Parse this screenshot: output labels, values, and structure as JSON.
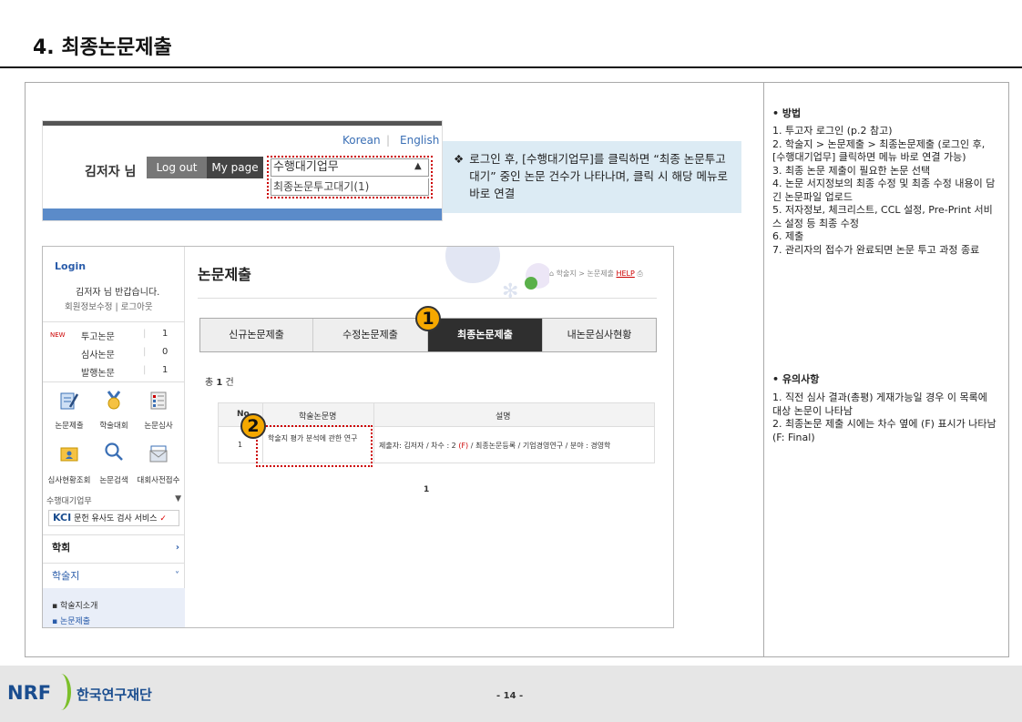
{
  "page": {
    "title": "4. 최종논문제출",
    "page_number": "- 14 -",
    "footer_logo": "NRF",
    "footer_org": "한국연구재단"
  },
  "header_shot": {
    "lang_korean": "Korean",
    "lang_sep": "|",
    "lang_english": "English",
    "user_name": "김저자 님",
    "logout": "Log out",
    "mypage": "My page",
    "dropdown_selected": "수행대기업무",
    "dropdown_arrow": "▲",
    "dropdown_option": "최종논문투고대기(1)"
  },
  "note": {
    "bullet": "❖",
    "text": "로그인 후, [수행대기업무]를 클릭하면 “최종 논문투고대기” 중인 논문 건수가 나타나며, 클릭 시 해당 메뉴로 바로 연결"
  },
  "sidebar": {
    "login": "Login",
    "greeting": "김저자 님 반갑습니다.",
    "links": "회원정보수정 | 로그아웃",
    "new_badge": "NEW",
    "stats": [
      {
        "label": "투고논문",
        "value": "1"
      },
      {
        "label": "심사논문",
        "value": "0"
      },
      {
        "label": "발행논문",
        "value": "1"
      }
    ],
    "icons_row1": [
      {
        "label": "논문제출",
        "icon": "doc-pen-icon"
      },
      {
        "label": "학술대회",
        "icon": "medal-icon"
      },
      {
        "label": "논문심사",
        "icon": "checklist-icon"
      }
    ],
    "icons_row2": [
      {
        "label": "심사현황조회",
        "icon": "folder-user-icon"
      },
      {
        "label": "논문검색",
        "icon": "search-icon"
      },
      {
        "label": "대회사전접수",
        "icon": "mail-icon"
      }
    ],
    "select_label": "수행대기업무",
    "select_arrow": "▼",
    "kci": "KCI",
    "kci_service": "문헌 유사도 검사 서비스",
    "kci_check": "✓",
    "menu_society": "학회",
    "menu_journal": "학술지",
    "submenu": [
      "▪ 학술지소개",
      "▪ 논문제출"
    ]
  },
  "main": {
    "title": "논문제출",
    "breadcrumb": "학술지 > 논문제출",
    "help": "HELP",
    "tabs": [
      "신규논문제출",
      "수정논문제출",
      "최종논문제출",
      "내논문심사현황"
    ],
    "active_tab": 2,
    "count_prefix": "총",
    "count_value": "1",
    "count_suffix": "건",
    "table": {
      "headers": [
        "No",
        "학술논문명",
        "설명"
      ],
      "rows": [
        {
          "no": "1",
          "name": "학술지 평가 분석에 관한 연구",
          "desc_a": "제출자: 김저자 / 차수 : 2",
          "desc_flag": "(F)",
          "desc_b": "/ 최종논문등록 / 기업경영연구 / 분야 : 경영학"
        }
      ]
    },
    "pager": "1"
  },
  "callouts": [
    "1",
    "2"
  ],
  "right_panel": {
    "method_title": "• 방법",
    "steps": [
      "1. 투고자 로그인 (p.2 참고)",
      "2. 학술지 > 논문제출 > 최종논문제출 (로그인 후, [수행대기업무] 클릭하면 메뉴 바로 연결 가능)",
      "3. 최종 논문 제출이 필요한 논문 선택",
      "4. 논문 서지정보의 최종 수정 및 최종 수정 내용이 담긴 논문파일 업로드",
      "5. 저자정보, 체크리스트, CCL 설정, Pre-Print 서비스 설정 등 최종 수정",
      "6. 제출",
      "7. 관리자의 접수가 완료되면 논문 투고 과정 종료"
    ],
    "notes_title": "•   유의사항",
    "notes": [
      "1. 직전 심사 결과(총평) 게재가능일 경우 이 목록에 대상 논문이 나타남",
      "2. 최종논문 제출 시에는 차수 옆에 (F) 표시가 나타남(F: Final)"
    ]
  }
}
